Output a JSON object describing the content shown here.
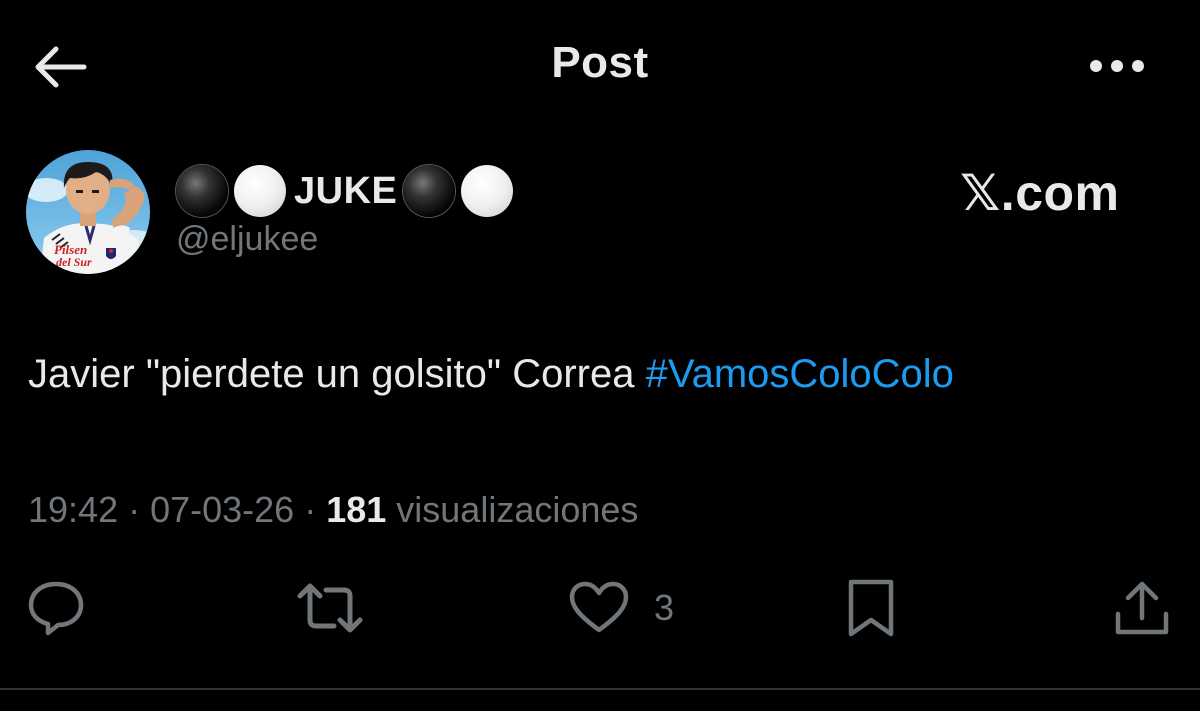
{
  "header": {
    "title": "Post",
    "back_icon": "arrow-left-icon",
    "more_icon": "more-horizontal-icon"
  },
  "author": {
    "display_name": "JUKE",
    "display_name_emoji": [
      "black-ball",
      "white-ball",
      "black-ball",
      "white-ball"
    ],
    "handle": "@eljukee",
    "avatar": {
      "jersey_text_line1": "Pilsen",
      "jersey_text_line2": "del Sur"
    }
  },
  "site": {
    "x_glyph": "𝕏",
    "domain": ".com"
  },
  "post": {
    "text": "Javier \"pierdete un golsito\" Correa ",
    "hashtag": "#VamosColoColo"
  },
  "meta": {
    "time": "19:42",
    "separator": " · ",
    "date": "07-03-26",
    "views_count": "181",
    "views_label": " visualizaciones"
  },
  "actions": {
    "reply_icon": "reply-icon",
    "repost_icon": "repost-icon",
    "like_icon": "heart-icon",
    "like_count": "3",
    "bookmark_icon": "bookmark-icon",
    "share_icon": "share-icon"
  },
  "colors": {
    "background": "#000000",
    "text_primary": "#e7e9ea",
    "text_secondary": "#71767b",
    "accent": "#1d9bf0",
    "divider": "#2f3336"
  }
}
